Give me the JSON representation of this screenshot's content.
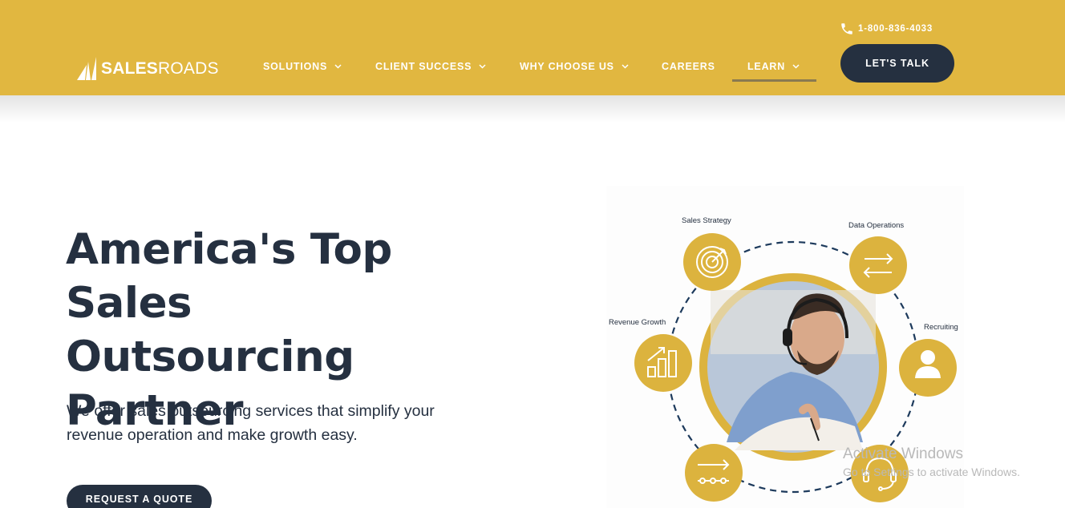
{
  "header": {
    "logo": {
      "bold": "SALES",
      "thin": "ROADS"
    },
    "nav": [
      {
        "label": "SOLUTIONS",
        "has_dropdown": true
      },
      {
        "label": "CLIENT SUCCESS",
        "has_dropdown": true
      },
      {
        "label": "WHY CHOOSE US",
        "has_dropdown": true
      },
      {
        "label": "CAREERS",
        "has_dropdown": false
      },
      {
        "label": "LEARN",
        "has_dropdown": true,
        "active": true
      }
    ],
    "phone": "1-800-836-4033",
    "cta_label": "LET'S TALK",
    "colors": {
      "header_bg": "#e1b740",
      "navy": "#253040",
      "accent": "#dcb33e"
    }
  },
  "hero": {
    "title_lines": [
      "America's Top Sales",
      "Outsourcing",
      "Partner"
    ],
    "subtitle_lines": [
      "We offer sales outsourcing services that simplify your",
      "revenue operation and make growth easy."
    ],
    "cta_label": "REQUEST A QUOTE"
  },
  "diagram": {
    "nodes": [
      {
        "label": "Sales Strategy",
        "icon": "target-icon"
      },
      {
        "label": "Data Operations",
        "icon": "exchange-arrows-icon"
      },
      {
        "label": "Recruiting",
        "icon": "person-icon"
      },
      {
        "label": "Revenue Growth",
        "icon": "growth-chart-icon"
      },
      {
        "label": "",
        "icon": "process-flow-icon"
      },
      {
        "label": "",
        "icon": "headset-icon"
      }
    ],
    "center_image": "man-with-headset-writing"
  },
  "watermark": {
    "line1": "Activate Windows",
    "line2": "Go to Settings to activate Windows."
  }
}
